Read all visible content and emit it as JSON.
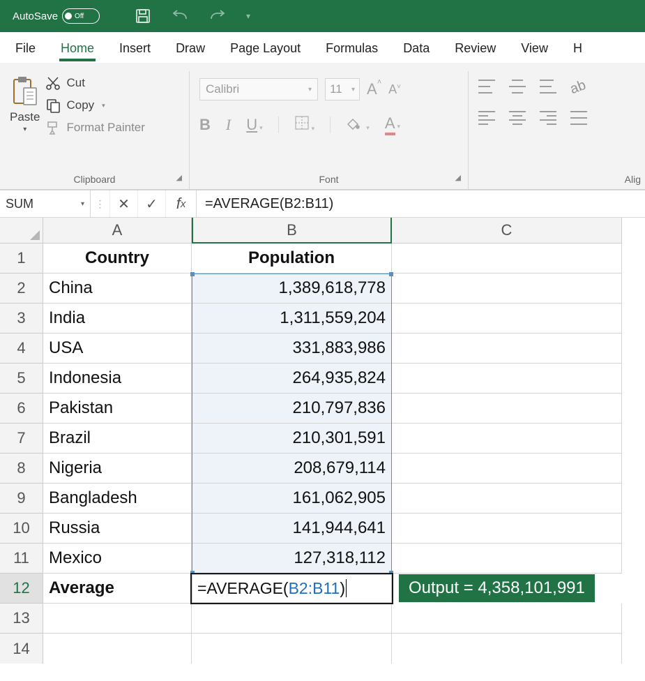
{
  "titlebar": {
    "autosave_label": "AutoSave",
    "autosave_state": "Off"
  },
  "tabs": {
    "file": "File",
    "home": "Home",
    "insert": "Insert",
    "draw": "Draw",
    "page_layout": "Page Layout",
    "formulas": "Formulas",
    "data": "Data",
    "review": "Review",
    "view": "View",
    "help_initial": "H"
  },
  "ribbon": {
    "clipboard": {
      "paste": "Paste",
      "cut": "Cut",
      "copy": "Copy",
      "format_painter": "Format Painter",
      "group_label": "Clipboard"
    },
    "font": {
      "name": "Calibri",
      "size": "11",
      "group_label": "Font"
    },
    "alignment": {
      "group_label_partial": "Alig"
    }
  },
  "formula_bar": {
    "name_box": "SUM",
    "fx_label": "fx",
    "formula": "=AVERAGE(B2:B11)"
  },
  "grid": {
    "columns": [
      "A",
      "B",
      "C"
    ],
    "row_numbers": [
      "1",
      "2",
      "3",
      "4",
      "5",
      "6",
      "7",
      "8",
      "9",
      "10",
      "11",
      "12",
      "13",
      "14"
    ],
    "headers": {
      "A": "Country",
      "B": "Population"
    },
    "rows": [
      {
        "country": "China",
        "population": "1,389,618,778"
      },
      {
        "country": "India",
        "population": "1,311,559,204"
      },
      {
        "country": "USA",
        "population": "331,883,986"
      },
      {
        "country": "Indonesia",
        "population": "264,935,824"
      },
      {
        "country": "Pakistan",
        "population": "210,797,836"
      },
      {
        "country": "Brazil",
        "population": "210,301,591"
      },
      {
        "country": "Nigeria",
        "population": "208,679,114"
      },
      {
        "country": "Bangladesh",
        "population": "161,062,905"
      },
      {
        "country": "Russia",
        "population": "141,944,641"
      },
      {
        "country": "Mexico",
        "population": "127,318,112"
      }
    ],
    "average_label": "Average",
    "active_cell": {
      "address": "B12",
      "prefix": "=AVERAGE(",
      "ref": "B2:B11",
      "suffix": ")"
    },
    "output_badge": "Output = 4,358,101,991"
  }
}
